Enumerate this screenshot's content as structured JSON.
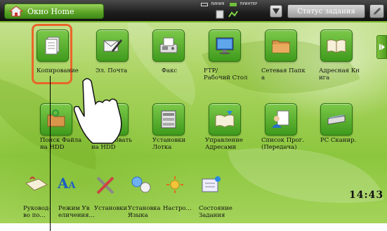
{
  "topbar": {
    "home_label": "Окно Home",
    "status_line1": "ЛИНИЯ",
    "status_line2": "ПРИНТЕР",
    "job_status_label": "Статус задания"
  },
  "apps": [
    {
      "name": "copy",
      "label": "Копирование",
      "icon": "copy-icon"
    },
    {
      "name": "email",
      "label": "Эл. Почта",
      "icon": "email-icon"
    },
    {
      "name": "fax",
      "label": "Факс",
      "icon": "fax-icon"
    },
    {
      "name": "ftp",
      "label": "FTP/\nРабочий Стол",
      "icon": "ftp-desktop-icon"
    },
    {
      "name": "network-folder",
      "label": "Сетевая Папк\nа",
      "icon": "network-folder-icon"
    },
    {
      "name": "address-book",
      "label": "Адресная Кн\nига",
      "icon": "address-book-icon"
    },
    {
      "name": "hdd-search",
      "label": "Поиск Файла\nна HDD",
      "icon": "folder-search-icon"
    },
    {
      "name": "scan-hdd",
      "label": "Сканировать\nна HDD",
      "icon": "scan-hdd-icon"
    },
    {
      "name": "tray-settings",
      "label": "Установки\nЛотка",
      "icon": "printer-tray-icon"
    },
    {
      "name": "address-control",
      "label": "Управление\nАдресами",
      "icon": "address-control-icon"
    },
    {
      "name": "program-list",
      "label": "Список Прог.\n(Передача)",
      "icon": "program-list-icon"
    },
    {
      "name": "pc-scan",
      "label": "PC Сканир.",
      "icon": "scanner-icon"
    }
  ],
  "bottom_items": [
    {
      "name": "guide",
      "label": "Руковод-\nво по…",
      "icon": "guide-book-icon"
    },
    {
      "name": "text-size",
      "label": "Режим Ув\nеличения…",
      "icon": "text-size-icon"
    },
    {
      "name": "settings",
      "label": "Установки",
      "icon": "tools-icon"
    },
    {
      "name": "language",
      "label": "Установка\nЯзыка",
      "icon": "language-icon"
    },
    {
      "name": "brightness",
      "label": "Настро…",
      "icon": "brightness-icon"
    },
    {
      "name": "job-status",
      "label": "Состояние\nЗадания",
      "icon": "job-status-icon"
    }
  ],
  "clock": "14:43",
  "colors": {
    "accent_green": "#5da527",
    "highlight_orange": "#e8662a",
    "topbar": "#1e1e1e"
  }
}
